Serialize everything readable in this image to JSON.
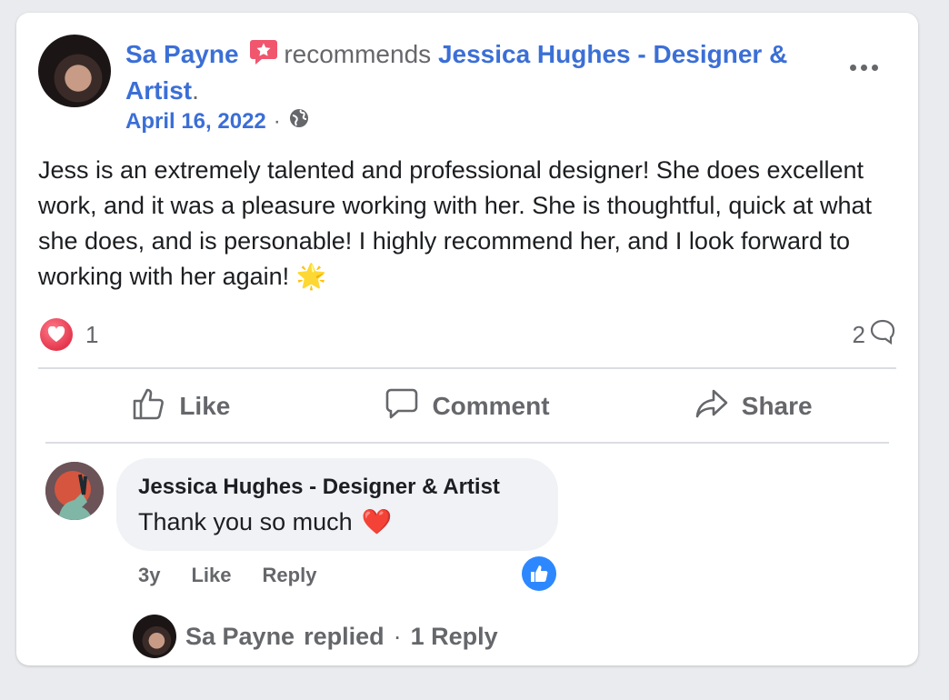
{
  "post": {
    "author": "Sa Payne",
    "recommends_text": "recommends",
    "page_name": "Jessica Hughes - Designer & Artist",
    "trailing_period": ".",
    "date": "April 16, 2022",
    "date_separator": "·",
    "body": "Jess is an extremely talented and professional designer! She does excellent work, and it was a pleasure working with her. She is thoughtful, quick at what she does, and is personable! I highly recommend her, and I look forward to working with her again!",
    "body_emoji": "🌟"
  },
  "stats": {
    "reaction_count": "1",
    "comment_count": "2"
  },
  "actions": {
    "like_label": "Like",
    "comment_label": "Comment",
    "share_label": "Share"
  },
  "comment": {
    "author": "Jessica Hughes - Designer & Artist",
    "text": "Thank you so much",
    "emoji": "❤️",
    "time": "3y",
    "like_label": "Like",
    "reply_label": "Reply"
  },
  "replies": {
    "author": "Sa Payne",
    "replied_text": "replied",
    "separator": "·",
    "count_label": "1 Reply"
  },
  "colors": {
    "link_blue": "#3b6fd6",
    "secondary_text": "#65676b",
    "love_red": "#e5374d",
    "like_blue": "#2d88ff",
    "bubble_bg": "#f0f2f5"
  }
}
